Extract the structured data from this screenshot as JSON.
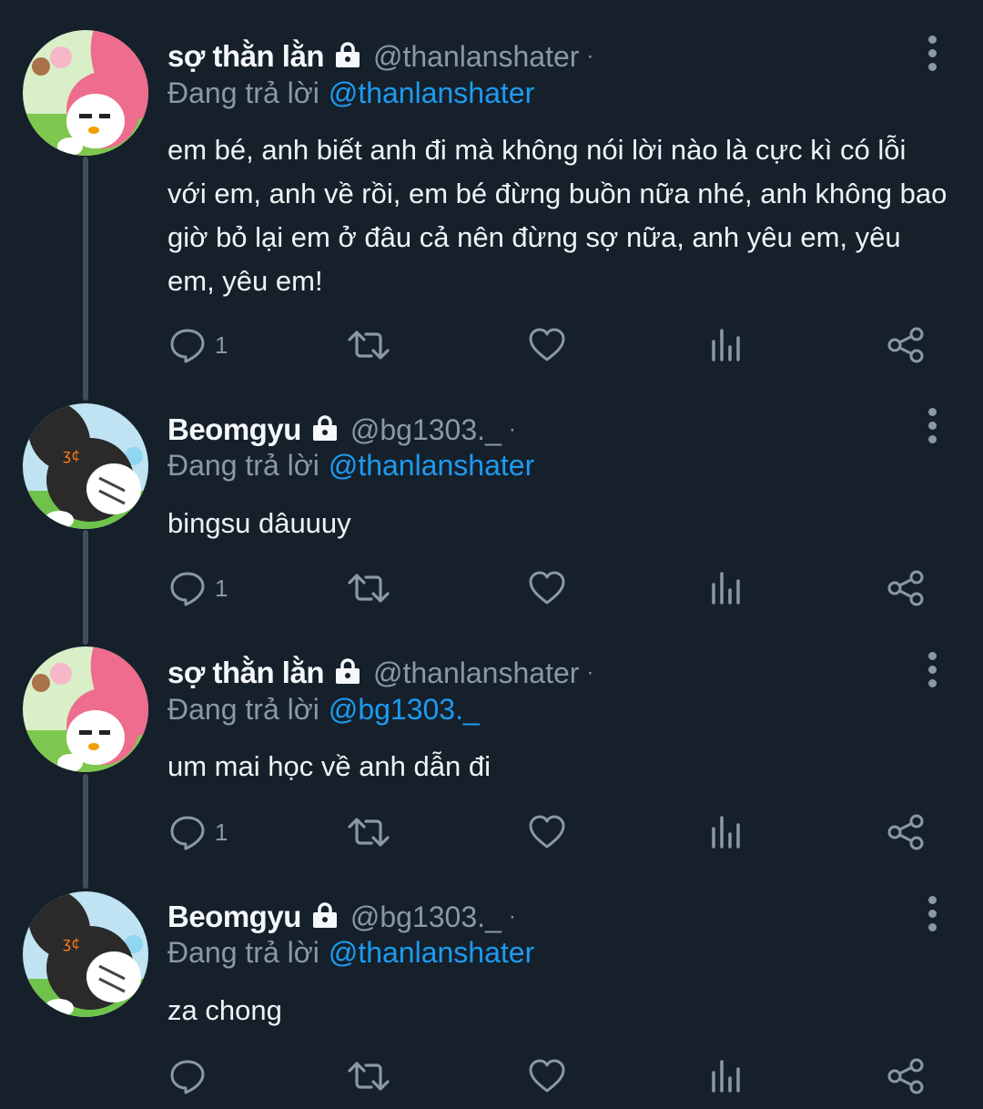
{
  "tweets": [
    {
      "name": "sợ thằn lằn",
      "handle": "@thanlanshater",
      "dot": "·",
      "reply_prefix": "Đang trả lời",
      "reply_to": "@thanlanshater",
      "text": "em bé, anh biết anh đi mà không nói lời nào là cực kì có lỗi với em, anh về rồi, em bé đừng buồn nữa nhé, anh không bao giờ bỏ lại em ở đâu cả nên đừng sợ nữa, anh yêu em, yêu em, yêu em!",
      "reply_count": "1",
      "avatar": "pink-bunny-avatar"
    },
    {
      "name": "Beomgyu",
      "handle": "@bg1303._",
      "dot": "·",
      "reply_prefix": "Đang trả lời",
      "reply_to": "@thanlanshater",
      "text": "bingsu dâuuuy",
      "reply_count": "1",
      "avatar": "black-bunny-avatar"
    },
    {
      "name": "sợ thằn lằn",
      "handle": "@thanlanshater",
      "dot": "·",
      "reply_prefix": "Đang trả lời",
      "reply_to": "@bg1303._",
      "text": "um mai học về anh dẫn đi",
      "reply_count": "1",
      "avatar": "pink-bunny-avatar"
    },
    {
      "name": "Beomgyu",
      "handle": "@bg1303._",
      "dot": "·",
      "reply_prefix": "Đang trả lời",
      "reply_to": "@thanlanshater",
      "text": "za chong",
      "reply_count": "",
      "avatar": "black-bunny-avatar"
    }
  ],
  "icons": {
    "reply": "reply-icon",
    "retweet": "retweet-icon",
    "like": "heart-icon",
    "views": "analytics-icon",
    "share": "share-icon",
    "more": "more-vertical-icon",
    "lock": "lock-icon"
  },
  "colors": {
    "background": "#15202b",
    "text": "#f0f3f5",
    "secondary": "#8b98a5",
    "mention": "#1d9bf0",
    "thread_line": "#414d59"
  }
}
